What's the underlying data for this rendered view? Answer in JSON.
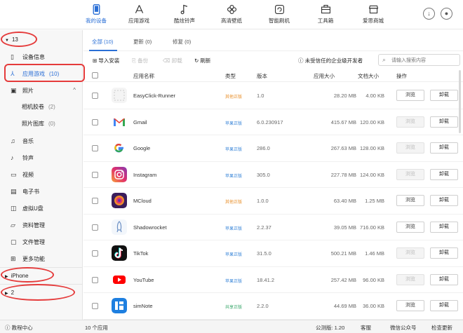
{
  "topnav": {
    "items": [
      {
        "label": "我的设备",
        "icon": "device-icon"
      },
      {
        "label": "应用游戏",
        "icon": "app-store-icon"
      },
      {
        "label": "酷炫铃声",
        "icon": "music-note-icon"
      },
      {
        "label": "高清壁纸",
        "icon": "flower-icon"
      },
      {
        "label": "智能刷机",
        "icon": "refresh-icon"
      },
      {
        "label": "工具箱",
        "icon": "toolbox-icon"
      },
      {
        "label": "爱思商城",
        "icon": "store-icon"
      }
    ],
    "active_color": "#2a6fd6"
  },
  "sidebar": {
    "device_header": "13",
    "items": {
      "device_info": "设备信息",
      "apps": "应用游戏",
      "apps_count": "(10)",
      "photos": "照片",
      "camera_roll": "相机胶卷",
      "camera_roll_count": "(2)",
      "photo_library": "照片图库",
      "photo_library_count": "(0)",
      "music": "音乐",
      "ringtones": "铃声",
      "video": "视频",
      "ebooks": "电子书",
      "udisk": "虚拟U盘",
      "data_mgmt": "资料管理",
      "file_mgmt": "文件管理",
      "more": "更多功能"
    },
    "iphone": "iPhone",
    "second": "2"
  },
  "tabs": {
    "all": "全部 (10)",
    "updates": "更新 (0)",
    "repair": "修复 (0)"
  },
  "toolbar": {
    "import": "导入安装",
    "backup": "备份",
    "uninstall": "卸载",
    "refresh": "刷新",
    "untrusted": "未受信任的企业级开发者",
    "search_placeholder": "请输入搜索内容"
  },
  "table": {
    "headers": {
      "name": "应用名称",
      "type": "类型",
      "version": "版本",
      "app_size": "应用大小",
      "doc_size": "文档大小",
      "actions": "操作"
    },
    "browse_label": "浏览",
    "uninstall_label": "卸载",
    "rows": [
      {
        "name": "EasyClick-Runner",
        "type": "其他正版",
        "type_color": "#e8902c",
        "version": "1.0",
        "app_size": "28.20 MB",
        "doc_size": "4.00 KB",
        "icon": "easyclick-icon",
        "browse_enabled": true
      },
      {
        "name": "Gmail",
        "type": "苹果正版",
        "type_color": "#3a86d8",
        "version": "6.0.230917",
        "app_size": "415.67 MB",
        "doc_size": "120.00 KB",
        "icon": "gmail-icon",
        "browse_enabled": false
      },
      {
        "name": "Google",
        "type": "苹果正版",
        "type_color": "#3a86d8",
        "version": "286.0",
        "app_size": "267.63 MB",
        "doc_size": "128.00 KB",
        "icon": "google-icon",
        "browse_enabled": false
      },
      {
        "name": "Instagram",
        "type": "苹果正版",
        "type_color": "#3a86d8",
        "version": "305.0",
        "app_size": "227.78 MB",
        "doc_size": "124.00 KB",
        "icon": "instagram-icon",
        "browse_enabled": false
      },
      {
        "name": "MCloud",
        "type": "其他正版",
        "type_color": "#e8902c",
        "version": "1.0.0",
        "app_size": "63.40 MB",
        "doc_size": "1.25 MB",
        "icon": "mcloud-icon",
        "browse_enabled": true
      },
      {
        "name": "Shadowrocket",
        "type": "苹果正版",
        "type_color": "#3a86d8",
        "version": "2.2.37",
        "app_size": "39.05 MB",
        "doc_size": "716.00 KB",
        "icon": "rocket-icon",
        "browse_enabled": true
      },
      {
        "name": "TikTok",
        "type": "苹果正版",
        "type_color": "#3a86d8",
        "version": "31.5.0",
        "app_size": "500.21 MB",
        "doc_size": "1.46 MB",
        "icon": "tiktok-icon",
        "browse_enabled": false
      },
      {
        "name": "YouTube",
        "type": "苹果正版",
        "type_color": "#3a86d8",
        "version": "18.41.2",
        "app_size": "257.42 MB",
        "doc_size": "96.00 KB",
        "icon": "youtube-icon",
        "browse_enabled": false
      },
      {
        "name": "simNote",
        "type": "共享正版",
        "type_color": "#3aa86b",
        "version": "2.2.0",
        "app_size": "44.69 MB",
        "doc_size": "36.00 KB",
        "icon": "simnote-icon",
        "browse_enabled": true
      }
    ]
  },
  "statusbar": {
    "tutorial": "教程中心",
    "count": "10 个应用",
    "beta": "公测版: 1.20",
    "service": "客服",
    "wechat": "微信公众号",
    "update": "检查更新"
  }
}
